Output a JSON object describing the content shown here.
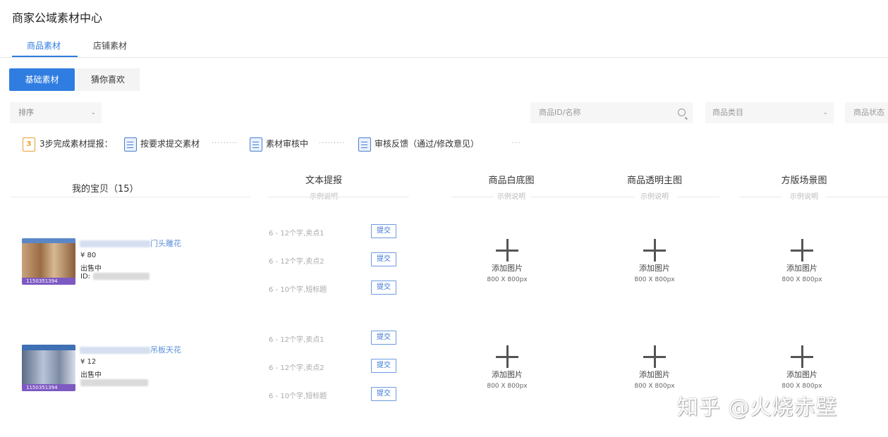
{
  "page": {
    "title": "商家公域素材中心"
  },
  "tabs": [
    {
      "label": "商品素材",
      "active": true
    },
    {
      "label": "店铺素材",
      "active": false
    }
  ],
  "subtabs": [
    {
      "label": "基础素材",
      "active": true
    },
    {
      "label": "猜你喜欢",
      "active": false
    }
  ],
  "filters": {
    "sort_placeholder": "排序",
    "search_placeholder": "商品ID/名称",
    "category_placeholder": "商品类目",
    "status_placeholder": "商品状态"
  },
  "steps": {
    "icon_text": "3",
    "intro": "3步完成素材提报：",
    "step1": "按要求提交素材",
    "step2": "素材审核中",
    "step3": "审核反馈（通过/修改意见）",
    "dots": "·········",
    "ellipsis": "···"
  },
  "table": {
    "my_items_label": "我的宝贝（15）",
    "columns": [
      {
        "title": "文本提报",
        "sub": "示例说明"
      },
      {
        "title": "商品白底图",
        "sub": "示例说明"
      },
      {
        "title": "商品透明主图",
        "sub": "示例说明"
      },
      {
        "title": "方版场景图",
        "sub": "示例说明"
      }
    ],
    "rows": [
      {
        "name_suffix": "门头雕花",
        "price": "¥ 80",
        "status": "出售中",
        "id_label": "ID:",
        "thumb_tag": "1150351394",
        "text_fields": [
          "6 - 12个字,卖点1",
          "6 - 12个字,卖点2",
          "6 - 10个字,短标题"
        ],
        "submit_label": "提交"
      },
      {
        "name_suffix": "吊板天花",
        "price": "¥ 12",
        "status": "出售中",
        "id_label": "",
        "thumb_tag": "1150351394",
        "text_fields": [
          "6 - 12个字,卖点1",
          "6 - 12个字,卖点2",
          "6 - 10个字,短标题"
        ],
        "submit_label": "提交"
      }
    ],
    "upload_label": "添加图片",
    "upload_size": "800 X 800px"
  },
  "watermark": "知乎 @火烧赤壁",
  "colors": {
    "accent": "#2f7de1",
    "link": "#5a8fd8",
    "icon_orange": "#e8a030"
  }
}
